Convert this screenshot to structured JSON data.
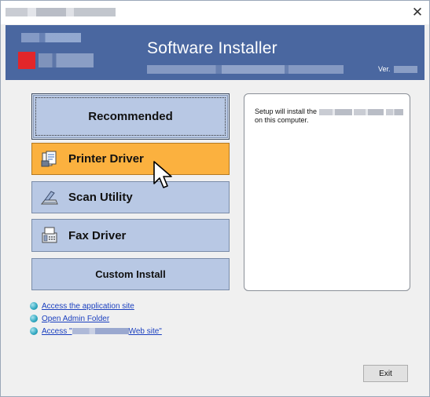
{
  "header": {
    "title": "Software Installer",
    "version_label": "Ver."
  },
  "buttons": {
    "recommended": "Recommended",
    "printer_driver": "Printer Driver",
    "scan_utility": "Scan Utility",
    "fax_driver": "Fax Driver",
    "custom_install": "Custom Install"
  },
  "info": {
    "prefix": "Setup will install the",
    "suffix": "on this computer."
  },
  "links": {
    "application_site": "Access the application site",
    "admin_folder": "Open Admin Folder",
    "web_site_prefix": "Access \"",
    "web_site_suffix": "Web site\""
  },
  "footer": {
    "exit_label": "Exit"
  },
  "colors": {
    "header_bg": "#4a67a0",
    "button_bg": "#b8c8e4",
    "hover_button_bg": "#fbb13f",
    "link": "#1a3fbf"
  },
  "icons": {
    "close": "close-icon",
    "printer": "printer-driver-icon",
    "scan": "scan-utility-icon",
    "fax": "fax-driver-icon",
    "bullet": "link-bullet-icon",
    "cursor": "mouse-pointer-icon"
  }
}
